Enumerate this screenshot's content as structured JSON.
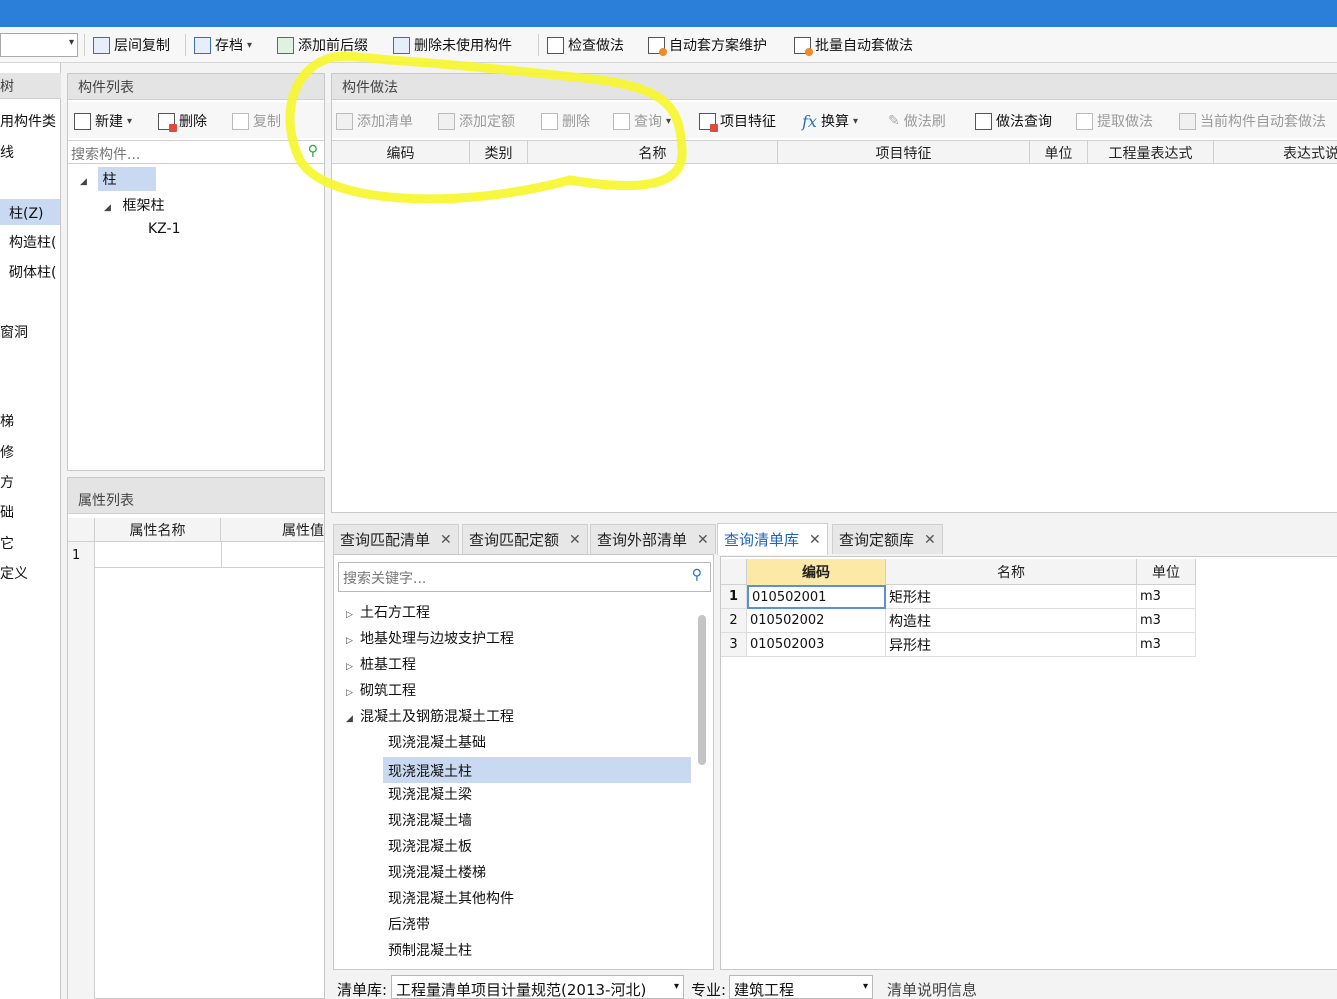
{
  "toolbar": {
    "combo_value": "",
    "buttons": [
      {
        "label": "层间复制"
      },
      {
        "label": "存档"
      },
      {
        "label": "添加前后缀"
      },
      {
        "label": "删除未使用构件"
      },
      {
        "label": "检查做法"
      },
      {
        "label": "自动套方案维护"
      },
      {
        "label": "批量自动套做法"
      }
    ]
  },
  "left_nav": {
    "header": "树",
    "items": [
      "用构件类",
      "线",
      "柱(Z)",
      "构造柱(",
      "砌体柱(",
      "窗洞",
      "梯",
      "修",
      "方",
      "础",
      "它",
      "定义"
    ]
  },
  "component_list": {
    "title": "构件列表",
    "new_label": "新建",
    "delete_label": "删除",
    "copy_label": "复制",
    "search_placeholder": "搜索构件...",
    "tree": [
      {
        "label": "柱"
      },
      {
        "label": "框架柱"
      },
      {
        "label": "KZ-1"
      }
    ]
  },
  "property_list": {
    "title": "属性列表",
    "col_name": "属性名称",
    "col_value": "属性值",
    "row_num": "1"
  },
  "method_panel": {
    "title": "构件做法",
    "buttons": {
      "add_list": "添加清单",
      "add_quota": "添加定额",
      "delete": "删除",
      "query": "查询",
      "features": "项目特征",
      "convert": "换算",
      "brush": "做法刷",
      "method_query": "做法查询",
      "extract": "提取做法",
      "auto_apply": "当前构件自动套做法"
    },
    "columns": [
      "编码",
      "类别",
      "名称",
      "项目特征",
      "单位",
      "工程量表达式",
      "表达式说明"
    ]
  },
  "bottom_tabs": [
    {
      "label": "查询匹配清单"
    },
    {
      "label": "查询匹配定额"
    },
    {
      "label": "查询外部清单"
    },
    {
      "label": "查询清单库"
    },
    {
      "label": "查询定额库"
    }
  ],
  "library": {
    "search_placeholder": "搜索关键字...",
    "tree": [
      {
        "label": "土石方工程"
      },
      {
        "label": "地基处理与边坡支护工程"
      },
      {
        "label": "桩基工程"
      },
      {
        "label": "砌筑工程"
      },
      {
        "label": "混凝土及钢筋混凝土工程"
      },
      {
        "label": "现浇混凝土基础"
      },
      {
        "label": "现浇混凝土柱"
      },
      {
        "label": "现浇混凝土梁"
      },
      {
        "label": "现浇混凝土墙"
      },
      {
        "label": "现浇混凝土板"
      },
      {
        "label": "现浇混凝土楼梯"
      },
      {
        "label": "现浇混凝土其他构件"
      },
      {
        "label": "后浇带"
      },
      {
        "label": "预制混凝土柱"
      }
    ],
    "result_columns": [
      "编码",
      "名称",
      "单位"
    ],
    "rows": [
      {
        "num": "1",
        "code": "010502001",
        "name": "矩形柱",
        "unit": "m3"
      },
      {
        "num": "2",
        "code": "010502002",
        "name": "构造柱",
        "unit": "m3"
      },
      {
        "num": "3",
        "code": "010502003",
        "name": "异形柱",
        "unit": "m3"
      }
    ]
  },
  "status_bar": {
    "lib_label": "清单库:",
    "lib_value": "工程量清单项目计量规范(2013-河北)",
    "major_label": "专业:",
    "major_value": "建筑工程",
    "info_label": "清单说明信息"
  },
  "colors": {
    "titlebar": "#2b7fd9",
    "highlight": "#fffe00",
    "selection": "#c9d9f1",
    "active_tab": "#1f64c4"
  }
}
